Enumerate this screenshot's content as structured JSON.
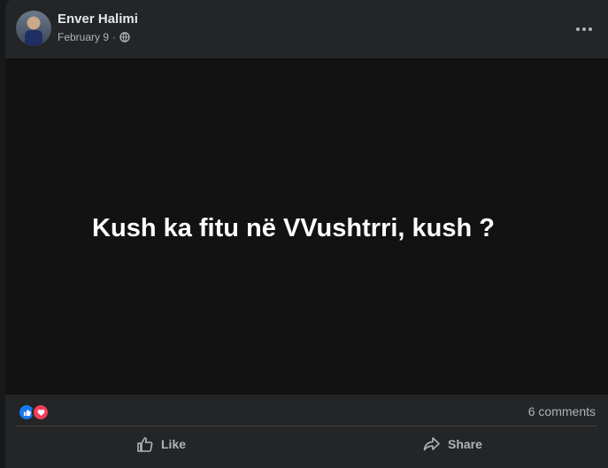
{
  "post": {
    "author": "Enver Halimi",
    "date": "February 9",
    "separator": "·",
    "privacy_icon": "globe-icon",
    "body_text": "Kush ka fitu në VVushtrri, kush ?"
  },
  "reactions": {
    "icons": [
      "like-reaction-icon",
      "love-reaction-icon"
    ],
    "comments_label": "6 comments"
  },
  "actions": {
    "like_label": "Like",
    "share_label": "Share"
  },
  "colors": {
    "like_blue": "#1877f2",
    "love_red": "#f33e58",
    "background": "#242526",
    "image_background": "#121213"
  }
}
